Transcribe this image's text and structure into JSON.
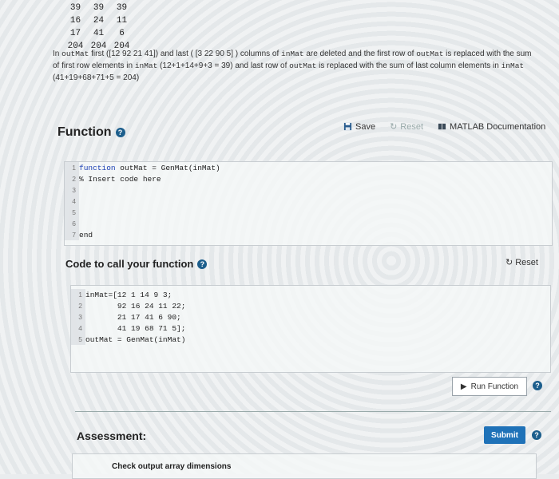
{
  "top_matrix": [
    [
      "39",
      "39",
      "39"
    ],
    [
      "16",
      "24",
      "11"
    ],
    [
      "17",
      "41",
      "6"
    ],
    [
      "204",
      "204",
      "204"
    ]
  ],
  "description": {
    "p1": "In ",
    "v1": "outMat",
    "p2": " first ([12 92 21 41]) and last ( [3 22 90 5] ) columns of ",
    "v2": "inMat",
    "p3": " are deleted and the first row of ",
    "v3": "outMat",
    "p4": " is replaced with the sum of first row elements in ",
    "v4": "inMat",
    "p5": " (12+1+14+9+3 = 39) and last row of ",
    "v5": "outMat",
    "p6": " is replaced with the sum of last column elements in ",
    "v6": "inMat",
    "p7": " (41+19+68+71+5 = 204)"
  },
  "function_section": {
    "title": "Function",
    "save_label": "Save",
    "reset_label": "Reset",
    "docs_label": "MATLAB Documentation",
    "lines": [
      {
        "n": "1",
        "kw": "function",
        "rest": " outMat = GenMat(inMat)"
      },
      {
        "n": "2",
        "cm": "% Insert code here"
      },
      {
        "n": "3"
      },
      {
        "n": "4"
      },
      {
        "n": "5"
      },
      {
        "n": "6"
      },
      {
        "n": "7",
        "kw": "end"
      }
    ]
  },
  "call_section": {
    "title": "Code to call your function",
    "reset_label": "Reset",
    "lines": [
      {
        "n": "1",
        "text": "inMat=[12 1 14 9 3;"
      },
      {
        "n": "2",
        "text": "       92 16 24 11 22;"
      },
      {
        "n": "3",
        "text": "       21 17 41 6 90;"
      },
      {
        "n": "4",
        "text": "       41 19 68 71 5];"
      },
      {
        "n": "5",
        "text": "outMat = GenMat(inMat)"
      }
    ]
  },
  "run_label": "Run Function",
  "assessment_title": "Assessment:",
  "submit_label": "Submit",
  "check_label": "Check output array dimensions",
  "colors": {
    "accent": "#1f72b8",
    "help": "#1c5e8c"
  }
}
